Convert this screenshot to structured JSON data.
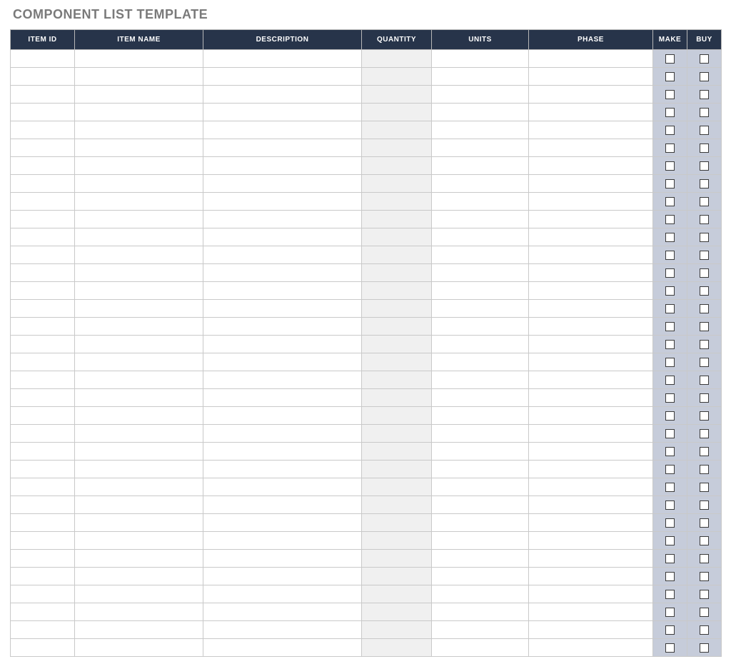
{
  "title": "COMPONENT LIST TEMPLATE",
  "columns": {
    "item_id": "ITEM ID",
    "item_name": "ITEM NAME",
    "description": "DESCRIPTION",
    "quantity": "QUANTITY",
    "units": "UNITS",
    "phase": "PHASE",
    "make": "MAKE",
    "buy": "BUY"
  },
  "row_count": 34,
  "rows": [
    {
      "item_id": "",
      "item_name": "",
      "description": "",
      "quantity": "",
      "units": "",
      "phase": "",
      "make": false,
      "buy": false
    },
    {
      "item_id": "",
      "item_name": "",
      "description": "",
      "quantity": "",
      "units": "",
      "phase": "",
      "make": false,
      "buy": false
    },
    {
      "item_id": "",
      "item_name": "",
      "description": "",
      "quantity": "",
      "units": "",
      "phase": "",
      "make": false,
      "buy": false
    },
    {
      "item_id": "",
      "item_name": "",
      "description": "",
      "quantity": "",
      "units": "",
      "phase": "",
      "make": false,
      "buy": false
    },
    {
      "item_id": "",
      "item_name": "",
      "description": "",
      "quantity": "",
      "units": "",
      "phase": "",
      "make": false,
      "buy": false
    },
    {
      "item_id": "",
      "item_name": "",
      "description": "",
      "quantity": "",
      "units": "",
      "phase": "",
      "make": false,
      "buy": false
    },
    {
      "item_id": "",
      "item_name": "",
      "description": "",
      "quantity": "",
      "units": "",
      "phase": "",
      "make": false,
      "buy": false
    },
    {
      "item_id": "",
      "item_name": "",
      "description": "",
      "quantity": "",
      "units": "",
      "phase": "",
      "make": false,
      "buy": false
    },
    {
      "item_id": "",
      "item_name": "",
      "description": "",
      "quantity": "",
      "units": "",
      "phase": "",
      "make": false,
      "buy": false
    },
    {
      "item_id": "",
      "item_name": "",
      "description": "",
      "quantity": "",
      "units": "",
      "phase": "",
      "make": false,
      "buy": false
    },
    {
      "item_id": "",
      "item_name": "",
      "description": "",
      "quantity": "",
      "units": "",
      "phase": "",
      "make": false,
      "buy": false
    },
    {
      "item_id": "",
      "item_name": "",
      "description": "",
      "quantity": "",
      "units": "",
      "phase": "",
      "make": false,
      "buy": false
    },
    {
      "item_id": "",
      "item_name": "",
      "description": "",
      "quantity": "",
      "units": "",
      "phase": "",
      "make": false,
      "buy": false
    },
    {
      "item_id": "",
      "item_name": "",
      "description": "",
      "quantity": "",
      "units": "",
      "phase": "",
      "make": false,
      "buy": false
    },
    {
      "item_id": "",
      "item_name": "",
      "description": "",
      "quantity": "",
      "units": "",
      "phase": "",
      "make": false,
      "buy": false
    },
    {
      "item_id": "",
      "item_name": "",
      "description": "",
      "quantity": "",
      "units": "",
      "phase": "",
      "make": false,
      "buy": false
    },
    {
      "item_id": "",
      "item_name": "",
      "description": "",
      "quantity": "",
      "units": "",
      "phase": "",
      "make": false,
      "buy": false
    },
    {
      "item_id": "",
      "item_name": "",
      "description": "",
      "quantity": "",
      "units": "",
      "phase": "",
      "make": false,
      "buy": false
    },
    {
      "item_id": "",
      "item_name": "",
      "description": "",
      "quantity": "",
      "units": "",
      "phase": "",
      "make": false,
      "buy": false
    },
    {
      "item_id": "",
      "item_name": "",
      "description": "",
      "quantity": "",
      "units": "",
      "phase": "",
      "make": false,
      "buy": false
    },
    {
      "item_id": "",
      "item_name": "",
      "description": "",
      "quantity": "",
      "units": "",
      "phase": "",
      "make": false,
      "buy": false
    },
    {
      "item_id": "",
      "item_name": "",
      "description": "",
      "quantity": "",
      "units": "",
      "phase": "",
      "make": false,
      "buy": false
    },
    {
      "item_id": "",
      "item_name": "",
      "description": "",
      "quantity": "",
      "units": "",
      "phase": "",
      "make": false,
      "buy": false
    },
    {
      "item_id": "",
      "item_name": "",
      "description": "",
      "quantity": "",
      "units": "",
      "phase": "",
      "make": false,
      "buy": false
    },
    {
      "item_id": "",
      "item_name": "",
      "description": "",
      "quantity": "",
      "units": "",
      "phase": "",
      "make": false,
      "buy": false
    },
    {
      "item_id": "",
      "item_name": "",
      "description": "",
      "quantity": "",
      "units": "",
      "phase": "",
      "make": false,
      "buy": false
    },
    {
      "item_id": "",
      "item_name": "",
      "description": "",
      "quantity": "",
      "units": "",
      "phase": "",
      "make": false,
      "buy": false
    },
    {
      "item_id": "",
      "item_name": "",
      "description": "",
      "quantity": "",
      "units": "",
      "phase": "",
      "make": false,
      "buy": false
    },
    {
      "item_id": "",
      "item_name": "",
      "description": "",
      "quantity": "",
      "units": "",
      "phase": "",
      "make": false,
      "buy": false
    },
    {
      "item_id": "",
      "item_name": "",
      "description": "",
      "quantity": "",
      "units": "",
      "phase": "",
      "make": false,
      "buy": false
    },
    {
      "item_id": "",
      "item_name": "",
      "description": "",
      "quantity": "",
      "units": "",
      "phase": "",
      "make": false,
      "buy": false
    },
    {
      "item_id": "",
      "item_name": "",
      "description": "",
      "quantity": "",
      "units": "",
      "phase": "",
      "make": false,
      "buy": false
    },
    {
      "item_id": "",
      "item_name": "",
      "description": "",
      "quantity": "",
      "units": "",
      "phase": "",
      "make": false,
      "buy": false
    },
    {
      "item_id": "",
      "item_name": "",
      "description": "",
      "quantity": "",
      "units": "",
      "phase": "",
      "make": false,
      "buy": false
    }
  ]
}
